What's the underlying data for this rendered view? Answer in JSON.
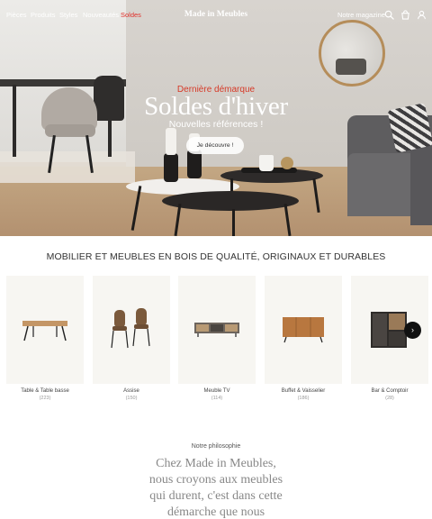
{
  "nav": {
    "links": [
      "Pièces",
      "Produits",
      "Styles",
      "Nouveautés",
      "Soldes"
    ],
    "brand": "Made in Meubles",
    "magazine": "Notre magazine",
    "icons": [
      "search-icon",
      "bag-icon",
      "user-icon"
    ]
  },
  "hero": {
    "eyebrow": "Dernière démarque",
    "title": "Soldes d'hiver",
    "subtitle": "Nouvelles références !",
    "cta": "Je découvre !"
  },
  "section": {
    "title": "MOBILIER ET MEUBLES EN BOIS DE QUALITÉ, ORIGINAUX ET DURABLES"
  },
  "categories": [
    {
      "label": "Table & Table basse",
      "count": "(223)"
    },
    {
      "label": "Assise",
      "count": "(150)"
    },
    {
      "label": "Meuble TV",
      "count": "(114)"
    },
    {
      "label": "Buffet & Vaisselier",
      "count": "(186)"
    },
    {
      "label": "Bar & Comptoir",
      "count": "(28)"
    }
  ],
  "philosophy": {
    "eyebrow": "Notre philosophie",
    "text": "Chez Made in Meubles, nous croyons aux meubles qui durent, c'est dans cette démarche que nous"
  },
  "colors": {
    "sale": "#e0312b",
    "eyebrow": "#d63a28",
    "card_bg": "#f7f6f2"
  }
}
